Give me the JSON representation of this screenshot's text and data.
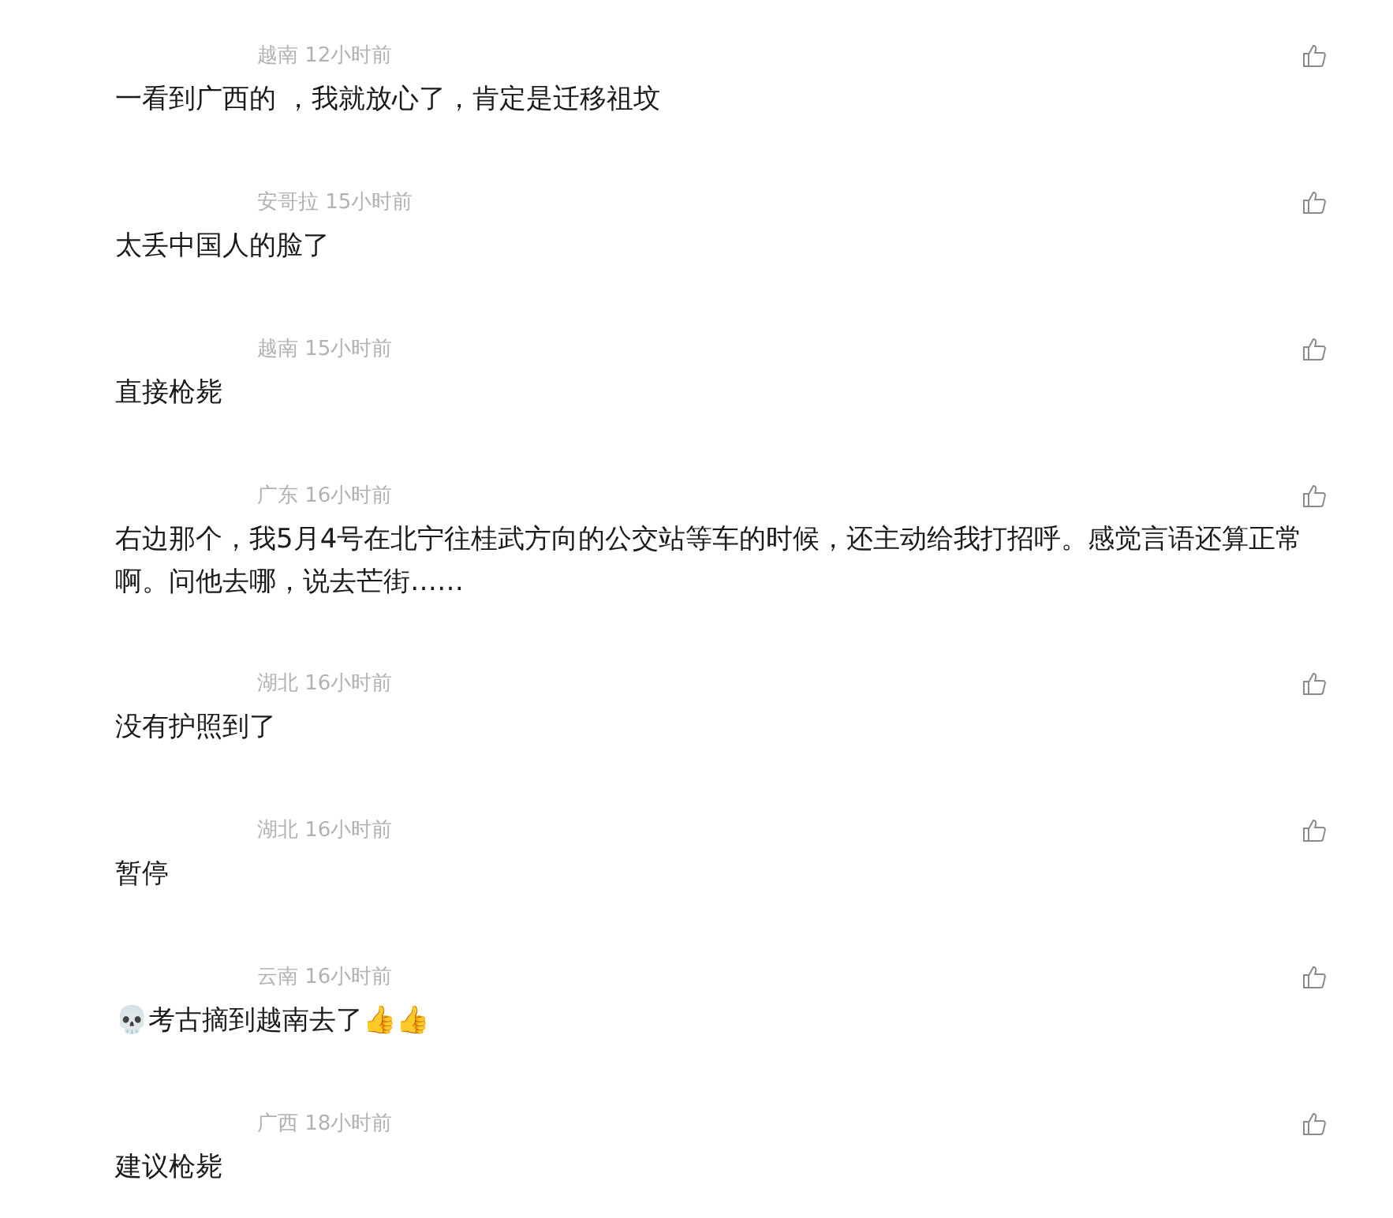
{
  "comments": [
    {
      "region": "越南",
      "time": "12小时前",
      "text": "一看到广西的 ，我就放心了，肯定是迁移祖坟"
    },
    {
      "region": "安哥拉",
      "time": "15小时前",
      "text": "太丢中国人的脸了"
    },
    {
      "region": "越南",
      "time": "15小时前",
      "text": "直接枪毙"
    },
    {
      "region": "广东",
      "time": "16小时前",
      "text": "右边那个，我5月4号在北宁往桂武方向的公交站等车的时候，还主动给我打招呼。感觉言语还算正常啊。问他去哪，说去芒街……"
    },
    {
      "region": "湖北",
      "time": "16小时前",
      "text": "没有护照到了"
    },
    {
      "region": "湖北",
      "time": "16小时前",
      "text": "暂停"
    },
    {
      "region": "云南",
      "time": "16小时前",
      "text": "💀考古摘到越南去了👍👍"
    },
    {
      "region": "广西",
      "time": "18小时前",
      "text": "建议枪毙"
    }
  ]
}
